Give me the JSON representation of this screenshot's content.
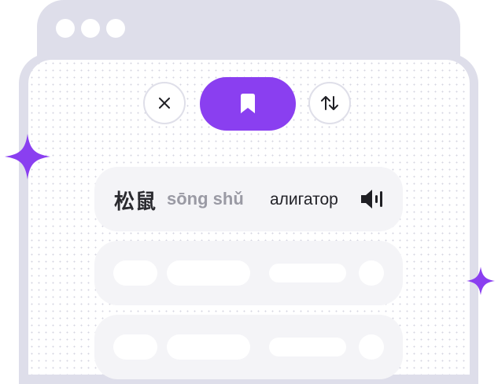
{
  "colors": {
    "accent": "#8a3ff0",
    "frame": "#dedeea",
    "row": "#f4f4f7"
  },
  "toolbar": {
    "close_icon": "close-icon",
    "bookmark_icon": "bookmark-icon",
    "swap_icon": "swap-vertical-icon"
  },
  "word_card": {
    "hanzi": "松鼠",
    "pinyin": "sōng shǔ",
    "translation": "алигатор",
    "audio_icon": "speaker-icon"
  },
  "placeholder_rows": 2
}
